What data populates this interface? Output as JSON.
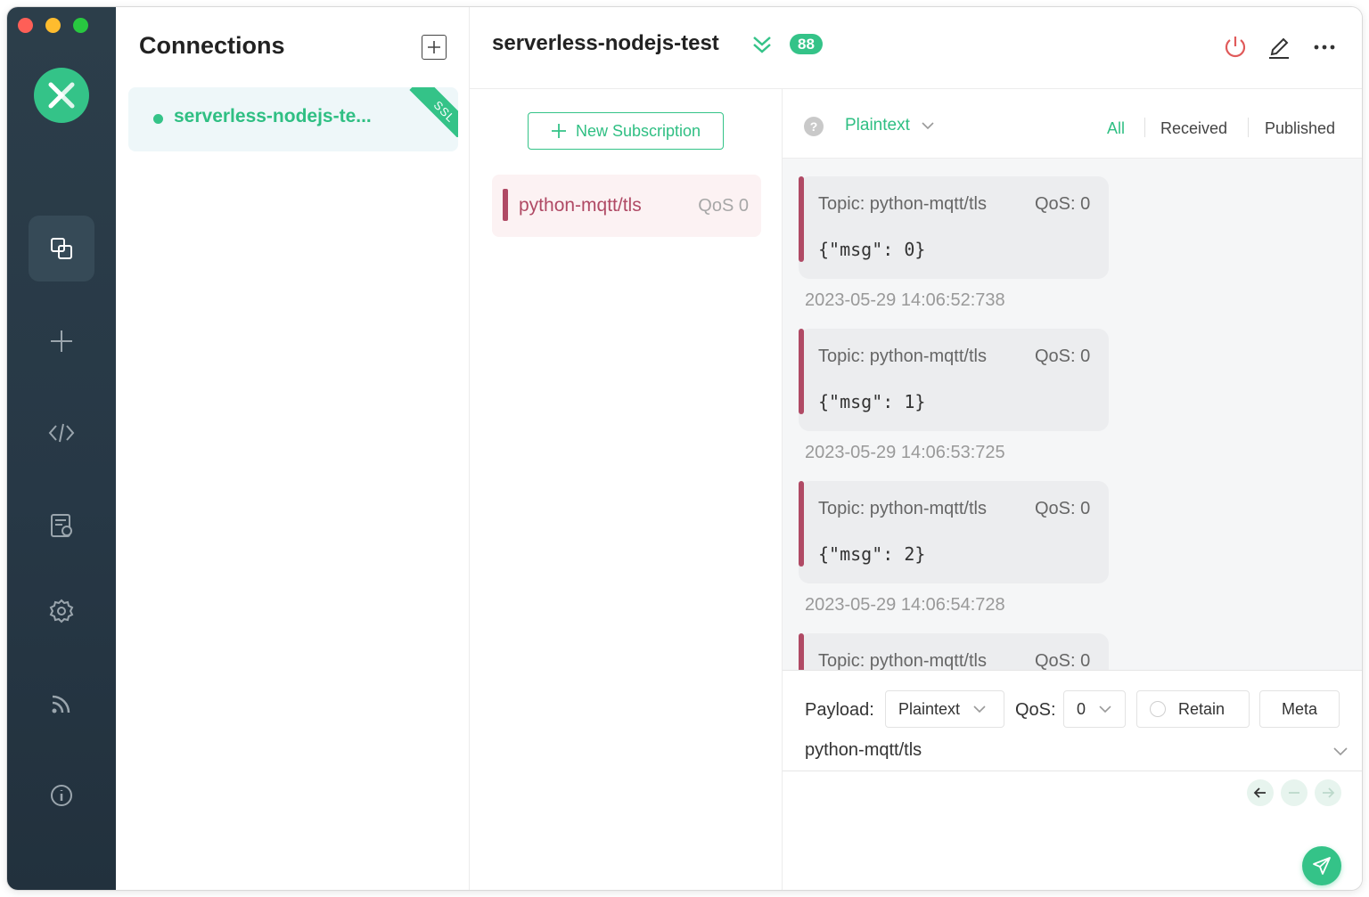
{
  "colors": {
    "accent": "#34c388",
    "topic": "#b04a65",
    "sidebar": "#273846",
    "danger": "#e05a5a"
  },
  "sidebar": {
    "items": [
      {
        "icon": "connections-icon",
        "active": true
      },
      {
        "icon": "plus-icon"
      },
      {
        "icon": "script-icon"
      },
      {
        "icon": "log-icon"
      },
      {
        "icon": "gear-icon"
      },
      {
        "icon": "rss-icon"
      },
      {
        "icon": "info-icon"
      }
    ]
  },
  "connections": {
    "title": "Connections",
    "items": [
      {
        "name": "serverless-nodejs-te...",
        "badge": "SSL",
        "status": "connected"
      }
    ]
  },
  "header": {
    "title": "serverless-nodejs-test",
    "badge": "88"
  },
  "subscriptions": {
    "new_button": "New Subscription",
    "items": [
      {
        "topic": "python-mqtt/tls",
        "qos": "QoS 0"
      }
    ]
  },
  "messages": {
    "format": "Plaintext",
    "filters": {
      "all": "All",
      "received": "Received",
      "published": "Published"
    },
    "items": [
      {
        "topic": "Topic: python-mqtt/tls",
        "qos": "QoS: 0",
        "payload": "{\"msg\": 0}",
        "time": "2023-05-29 14:06:52:738"
      },
      {
        "topic": "Topic: python-mqtt/tls",
        "qos": "QoS: 0",
        "payload": "{\"msg\": 1}",
        "time": "2023-05-29 14:06:53:725"
      },
      {
        "topic": "Topic: python-mqtt/tls",
        "qos": "QoS: 0",
        "payload": "{\"msg\": 2}",
        "time": "2023-05-29 14:06:54:728"
      },
      {
        "topic": "Topic: python-mqtt/tls",
        "qos": "QoS: 0",
        "payload": "",
        "time": ""
      }
    ]
  },
  "publish": {
    "payload_label": "Payload:",
    "payload_format": "Plaintext",
    "qos_label": "QoS:",
    "qos_value": "0",
    "retain_label": "Retain",
    "meta_label": "Meta",
    "topic": "python-mqtt/tls"
  }
}
